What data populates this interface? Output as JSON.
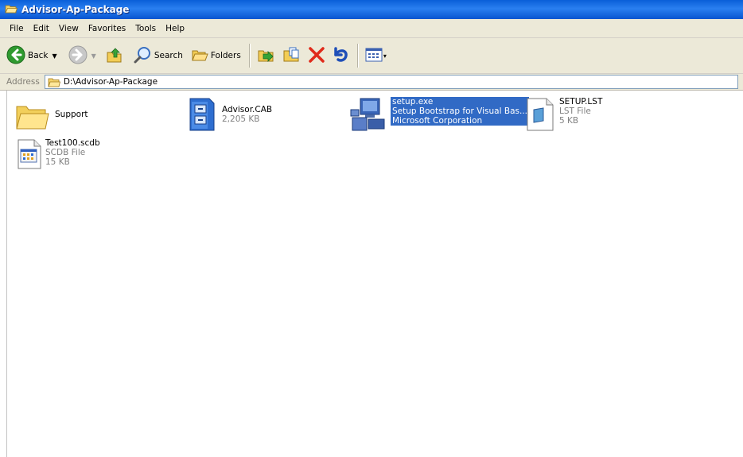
{
  "window": {
    "title": "Advisor-Ap-Package"
  },
  "menu": [
    "File",
    "Edit",
    "View",
    "Favorites",
    "Tools",
    "Help"
  ],
  "toolbar": {
    "back_label": "Back",
    "search_label": "Search",
    "folders_label": "Folders"
  },
  "address": {
    "label": "Address",
    "value": "D:\\Advisor-Ap-Package"
  },
  "files": [
    {
      "name": "Support",
      "line2": "",
      "line3": "",
      "icon": "folder-icon"
    },
    {
      "name": "Advisor.CAB",
      "line2": "2,205 KB",
      "line3": "",
      "icon": "cabinet-icon"
    },
    {
      "name": "setup.exe",
      "line2": "Setup Bootstrap for Visual Bas...",
      "line3": "Microsoft Corporation",
      "icon": "setup-computer-icon",
      "selected": true
    },
    {
      "name": "SETUP.LST",
      "line2": "LST File",
      "line3": "5 KB",
      "icon": "document-icon"
    },
    {
      "name": "Test100.scdb",
      "line2": "SCDB File",
      "line3": "15 KB",
      "icon": "scdb-file-icon"
    }
  ],
  "colors": {
    "title_bar": "#0a5fd8",
    "selection": "#316ac5",
    "chrome": "#ece9d8"
  }
}
